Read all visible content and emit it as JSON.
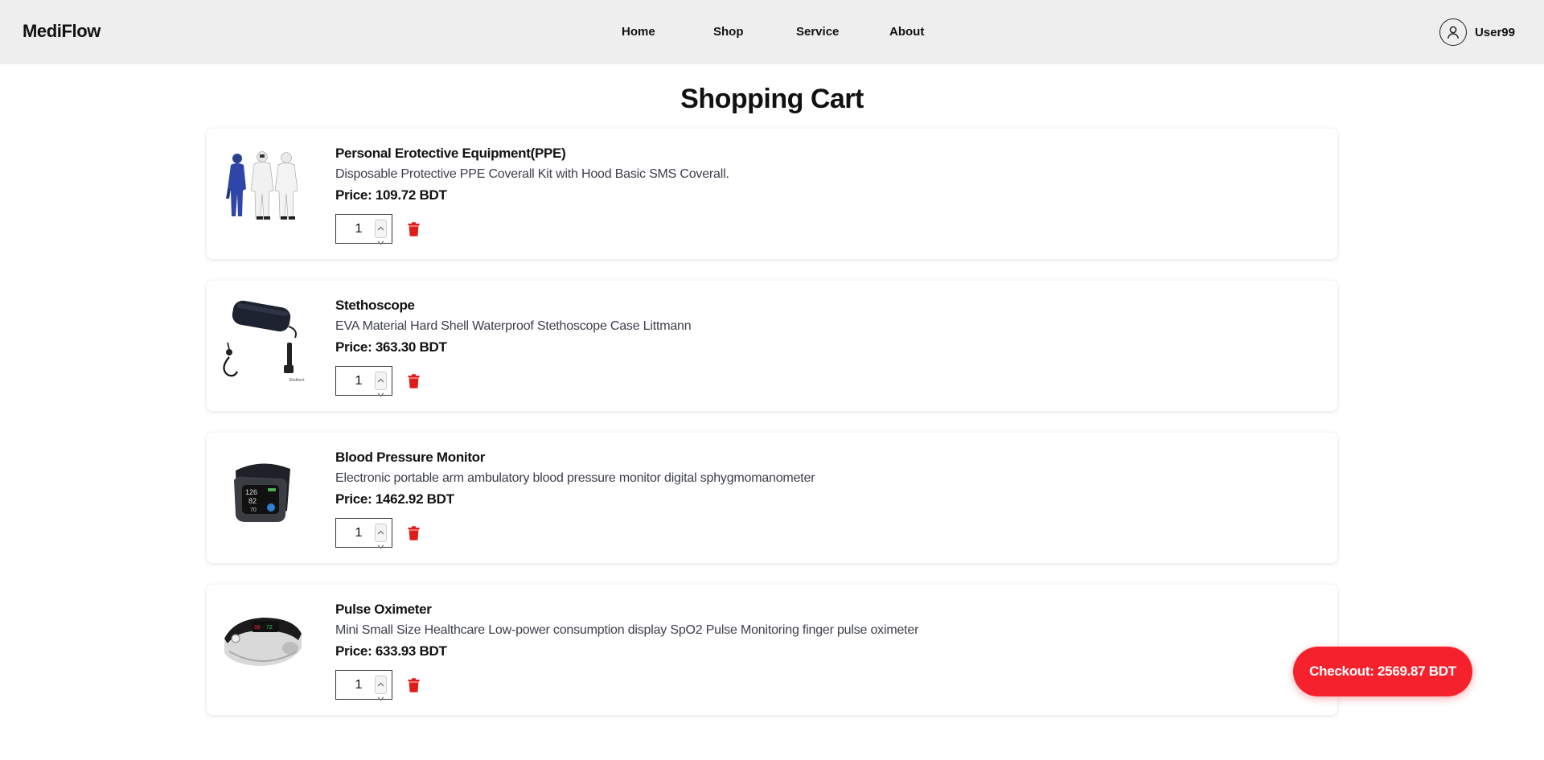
{
  "header": {
    "brand": "MediFlow",
    "nav": {
      "home": "Home",
      "shop": "Shop",
      "service": "Service",
      "about": "About"
    },
    "user": {
      "name": "User99",
      "icon": "user-icon"
    }
  },
  "page": {
    "title": "Shopping Cart"
  },
  "cart": {
    "items": [
      {
        "name": "Personal Erotective Equipment(PPE)",
        "description": "Disposable Protective PPE Coverall Kit with Hood Basic SMS Coverall.",
        "price": "Price: 109.72 BDT",
        "quantity": "1",
        "image": "ppe-coverall-image"
      },
      {
        "name": "Stethoscope",
        "description": "EVA Material Hard Shell Waterproof Stethoscope Case Littmann",
        "price": "Price: 363.30 BDT",
        "quantity": "1",
        "image": "stethoscope-image"
      },
      {
        "name": "Blood Pressure Monitor",
        "description": "Electronic portable arm ambulatory blood pressure monitor digital sphygmomanometer",
        "price": "Price: 1462.92 BDT",
        "quantity": "1",
        "image": "blood-pressure-monitor-image"
      },
      {
        "name": "Pulse Oximeter",
        "description": "Mini Small Size Healthcare Low-power consumption display SpO2 Pulse Monitoring finger pulse oximeter",
        "price": "Price: 633.93 BDT",
        "quantity": "1",
        "image": "pulse-oximeter-image"
      }
    ],
    "delete_icon": "trash-icon"
  },
  "checkout": {
    "label": "Checkout: 2569.87 BDT"
  },
  "colors": {
    "header_bg": "#eeeeee",
    "accent_red": "#f5222d",
    "trash_red": "#e01b1b",
    "text": "#111111",
    "muted_text": "#3c3f4a"
  }
}
